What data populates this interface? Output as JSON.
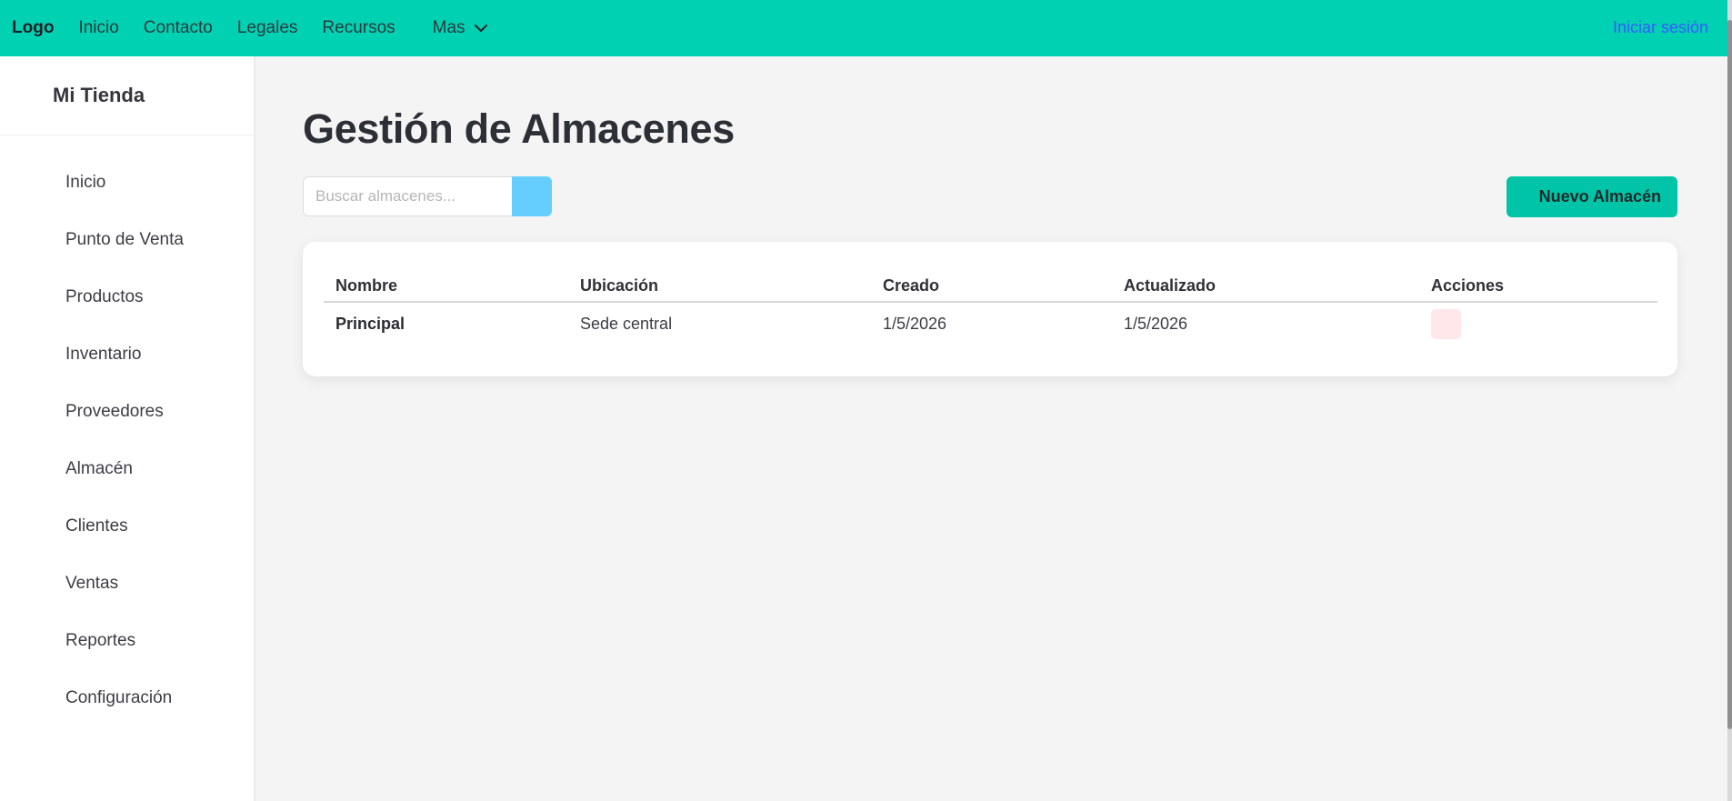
{
  "topbar": {
    "logo": "Logo",
    "links": [
      "Inicio",
      "Contacto",
      "Legales",
      "Recursos"
    ],
    "more_label": "Mas",
    "login_label": "Iniciar sesión"
  },
  "sidebar": {
    "store_name": "Mi Tienda",
    "items": [
      "Inicio",
      "Punto de Venta",
      "Productos",
      "Inventario",
      "Proveedores",
      "Almacén",
      "Clientes",
      "Ventas",
      "Reportes",
      "Configuración"
    ]
  },
  "main": {
    "title": "Gestión de Almacenes",
    "search_placeholder": "Buscar almacenes...",
    "new_button_label": "Nuevo Almacén"
  },
  "table": {
    "headers": [
      "Nombre",
      "Ubicación",
      "Creado",
      "Actualizado",
      "Acciones"
    ],
    "rows": [
      {
        "name": "Principal",
        "location": "Sede central",
        "created": "1/5/2026",
        "updated": "1/5/2026"
      }
    ]
  },
  "colors": {
    "topbar": "#00d1b2",
    "primary_button": "#00c4a7",
    "search_button": "#66cdff",
    "login_link": "#3a5bff",
    "delete_action": "#ffe7ea"
  }
}
